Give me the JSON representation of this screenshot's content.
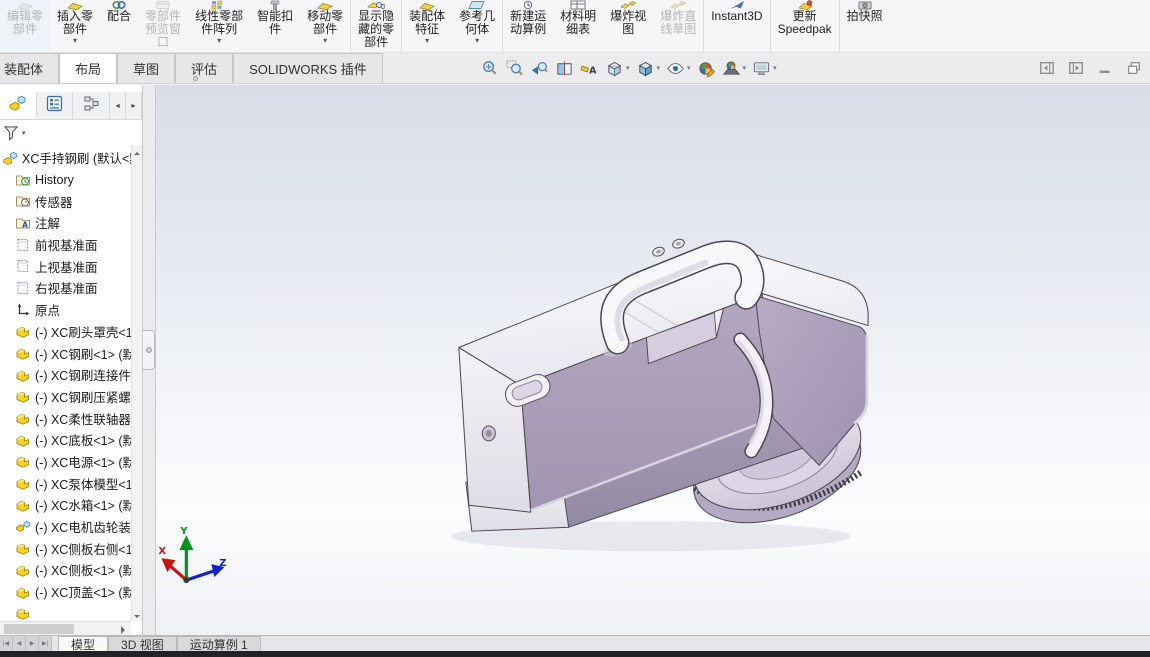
{
  "ribbon": {
    "buttons": [
      {
        "name": "edit-component-button",
        "label": "编辑零\n部件",
        "icon": "chip-edit",
        "disabled": true
      },
      {
        "name": "insert-component-button",
        "label": "插入零\n部件",
        "icon": "chip-yellow",
        "arrow": true
      },
      {
        "name": "mate-button",
        "label": "配合",
        "icon": "chip-mate"
      },
      {
        "name": "component-preview-button",
        "label": "零部件\n预览窗\n口",
        "icon": "chip-window",
        "disabled": true
      },
      {
        "name": "linear-pattern-button",
        "label": "线性零部\n件阵列",
        "icon": "chip-pattern",
        "arrow": true
      },
      {
        "name": "smart-fasteners-button",
        "label": "智能扣\n件",
        "icon": "chip-bolt"
      },
      {
        "name": "move-component-button",
        "label": "移动零\n部件",
        "icon": "chip-yellow",
        "arrow": true,
        "sep_after": true
      },
      {
        "name": "show-hidden-components-button",
        "label": "显示隐\n藏的零\n部件",
        "icon": "chip-glasses",
        "sep_after": true
      },
      {
        "name": "assembly-features-button",
        "label": "装配体\n特征",
        "icon": "chip-yellow",
        "arrow": true
      },
      {
        "name": "reference-geometry-button",
        "label": "参考几\n何体",
        "icon": "chip-plane",
        "arrow": true,
        "sep_after": true
      },
      {
        "name": "new-motion-study-button",
        "label": "新建运\n动算例",
        "icon": "chip-motion"
      },
      {
        "name": "bill-of-materials-button",
        "label": "材料明\n细表",
        "icon": "chip-table"
      },
      {
        "name": "exploded-view-button",
        "label": "爆炸视\n图",
        "icon": "chip-explode"
      },
      {
        "name": "explode-line-sketch-button",
        "label": "爆炸直\n线草图",
        "icon": "chip-explode",
        "disabled": true,
        "sep_after": true
      },
      {
        "name": "instant3d-button",
        "label": "Instant3D",
        "icon": "chip-instant3d",
        "sep_after": true
      },
      {
        "name": "update-speedpak-button",
        "label": "更新\nSpeedpak",
        "icon": "chip-speedpak",
        "sep_after": true
      },
      {
        "name": "take-snapshot-button",
        "label": "拍快照",
        "icon": "chip-camera"
      }
    ]
  },
  "command_tabs": {
    "items": [
      {
        "name": "tab-assembly",
        "label": "装配体"
      },
      {
        "name": "tab-layout",
        "label": "布局",
        "active": true
      },
      {
        "name": "tab-sketch",
        "label": "草图"
      },
      {
        "name": "tab-evaluate",
        "label": "评估"
      },
      {
        "name": "tab-solidworks-addins",
        "label": "SOLIDWORKS 插件"
      }
    ]
  },
  "headsup": {
    "icons": [
      {
        "name": "zoom-to-fit-button",
        "icon": "zoom-to-fit"
      },
      {
        "name": "zoom-to-area-button",
        "icon": "zoom-to-area"
      },
      {
        "name": "previous-view-button",
        "icon": "previous-view"
      },
      {
        "name": "section-view-button",
        "icon": "section-view"
      },
      {
        "name": "view-annotations-button",
        "icon": "view-annotations"
      },
      {
        "name": "view-orientation-button",
        "icon": "view-orientation",
        "arrow": true
      },
      {
        "name": "display-style-button",
        "icon": "display-style",
        "arrow": true
      },
      {
        "name": "hide-show-items-button",
        "icon": "hide-show-items",
        "arrow": true
      },
      {
        "name": "edit-appearance-button",
        "icon": "edit-appearance"
      },
      {
        "name": "apply-scene-button",
        "icon": "apply-scene",
        "arrow": true
      },
      {
        "name": "view-settings-button",
        "icon": "view-settings",
        "arrow": true
      }
    ]
  },
  "window_controls": {
    "items": [
      {
        "name": "collapse-pane-left-button",
        "icon": "collapse-left"
      },
      {
        "name": "collapse-pane-right-button",
        "icon": "collapse-right"
      },
      {
        "name": "minimize-button",
        "icon": "minimize"
      },
      {
        "name": "restore-button",
        "icon": "restore"
      }
    ]
  },
  "left_panel": {
    "tabs": {
      "items": [
        {
          "name": "featuremanager-tab",
          "icon": "feature-manager",
          "active": true
        },
        {
          "name": "propertymanager-tab",
          "icon": "property-manager"
        },
        {
          "name": "configurationmanager-tab",
          "icon": "configuration-manager"
        },
        {
          "name": "panel-tab-scroll-left",
          "label": "◂",
          "cls": "ptab-arrow"
        },
        {
          "name": "panel-tab-scroll-right",
          "label": "▸",
          "cls": "ptab-arrow"
        }
      ]
    },
    "tree": {
      "root": "XC手持钢刷 (默认<默",
      "items": [
        {
          "icon": "history-folder",
          "label": "History"
        },
        {
          "icon": "sensors-folder",
          "label": "传感器"
        },
        {
          "icon": "annotations-folder",
          "label": "注解"
        },
        {
          "icon": "plane",
          "label": "前视基准面"
        },
        {
          "icon": "plane",
          "label": "上视基准面"
        },
        {
          "icon": "plane",
          "label": "右视基准面"
        },
        {
          "icon": "origin",
          "label": "原点"
        },
        {
          "icon": "part",
          "label": "(-) XC刷头罩壳<1"
        },
        {
          "icon": "part",
          "label": "(-) XC钢刷<1> (默"
        },
        {
          "icon": "part",
          "label": "(-) XC钢刷连接件"
        },
        {
          "icon": "part",
          "label": "(-) XC钢刷压紧螺"
        },
        {
          "icon": "part",
          "label": "(-) XC柔性联轴器"
        },
        {
          "icon": "part",
          "label": "(-) XC底板<1> (默"
        },
        {
          "icon": "part",
          "label": "(-) XC电源<1> (默"
        },
        {
          "icon": "part",
          "label": "(-) XC泵体模型<1"
        },
        {
          "icon": "part",
          "label": "(-) XC水箱<1> (默"
        },
        {
          "icon": "subassembly",
          "label": "(-) XC电机齿轮装"
        },
        {
          "icon": "part",
          "label": "(-) XC侧板右侧<1"
        },
        {
          "icon": "part",
          "label": "(-) XC侧板<1> (默"
        },
        {
          "icon": "part",
          "label": "(-) XC顶盖<1> (默"
        },
        {
          "icon": "part",
          "label": ""
        }
      ]
    }
  },
  "viewport": {
    "triad": {
      "x_label": "X",
      "y_label": "Y",
      "z_label": "Z"
    }
  },
  "bottom_bar": {
    "nav": [
      {
        "name": "scroll-first-tab-button",
        "label": "|◀"
      },
      {
        "name": "scroll-prev-tab-button",
        "label": "◀"
      },
      {
        "name": "scroll-next-tab-button",
        "label": "▶"
      },
      {
        "name": "scroll-last-tab-button",
        "label": "▶|"
      }
    ],
    "tabs": [
      {
        "name": "model-tab",
        "label": "模型",
        "active": true
      },
      {
        "name": "3d-views-tab",
        "label": "3D 视图"
      },
      {
        "name": "motion-study-tab",
        "label": "运动算例 1"
      }
    ]
  },
  "colors": {
    "model_face_mauve": "#a89cb6",
    "model_face_dark": "#998ca8",
    "model_white": "#f8f7fa",
    "viewport_top": "#d8dde7",
    "viewport_bottom": "#fbfcfd",
    "triad_x": "#cc1111",
    "triad_y": "#00941e",
    "triad_z": "#1122cc",
    "status_strip": "#222326"
  }
}
